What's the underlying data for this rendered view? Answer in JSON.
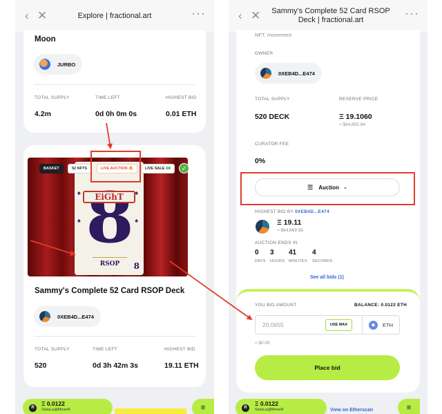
{
  "left": {
    "window_title": "Explore | fractional.art",
    "top_card": {
      "title": "Moon",
      "owner": "JURBO",
      "stats": [
        {
          "label": "TOTAL SUPPLY",
          "value": "4.2m"
        },
        {
          "label": "TIME LEFT",
          "value": "0d 0h 0m 0s"
        },
        {
          "label": "HIGHEST BID",
          "value": "0.01 ETH"
        }
      ]
    },
    "nft_card": {
      "tags": [
        "BASKET",
        "52 NFTS",
        "LIVE AUCTION 🔥",
        "LIVE SALE 💵"
      ],
      "image_text": {
        "banner": "EiGhT",
        "glyph": "8",
        "brand": "RSOP",
        "corner": "8"
      },
      "title": "Sammy's Complete 52 Card RSOP Deck",
      "owner": "0XEB4D...E474",
      "stats": [
        {
          "label": "TOTAL SUPPLY",
          "value": "520"
        },
        {
          "label": "TIME LEFT",
          "value": "0d 3h 42m 3s"
        },
        {
          "label": "HIGHEST BID",
          "value": "19.11 ETH"
        }
      ]
    },
    "bottom": {
      "balance": "Ξ 0.0122",
      "user": "SielaLa@MinerR"
    }
  },
  "right": {
    "window_title": "Sammy's Complete 52 Card RSOP Deck | fractional.art",
    "desc_tail": "NFT. movement.",
    "owner_label": "OWNER",
    "owner": "0XEB4D...E474",
    "total_supply_label": "TOTAL SUPPLY",
    "total_supply": "520 DECK",
    "reserve_label": "RESERVE PRICE",
    "reserve_value": "Ξ 19.1060",
    "reserve_usd": "≈ $64,855.94",
    "curator_label": "CURATOR FEE",
    "curator_value": "0%",
    "auction_button": "Auction",
    "highest_bid_prefix": "HIGHEST BID BY",
    "highest_bid_by": "0XEB4D...E474",
    "highest_bid": "Ξ 19.11",
    "highest_bid_usd": "≈ $64,869.56",
    "ends_label": "AUCTION ENDS IN",
    "countdown": [
      {
        "n": "0",
        "u": "DAYS"
      },
      {
        "n": "3",
        "u": "HOURS"
      },
      {
        "n": "41",
        "u": "MINUTES"
      },
      {
        "n": "4",
        "u": "SECONDS"
      }
    ],
    "see_all": "See all bids (1)",
    "bid_label": "YOU BID AMOUNT",
    "balance": "BALANCE: 0.0122 ETH",
    "bid_value": "20.0655",
    "use_max": "USE MAX",
    "currency": "ETH",
    "bid_usd": "≈ $0.00",
    "place_bid": "Place bid",
    "bottom": {
      "balance": "Ξ 0.0122",
      "user": "SielaLa@MinerR",
      "etherscan": "View on Etherscan"
    }
  },
  "colors": {
    "accent": "#b7ec44",
    "annotation": "#e23a2a",
    "link": "#3866d6"
  }
}
